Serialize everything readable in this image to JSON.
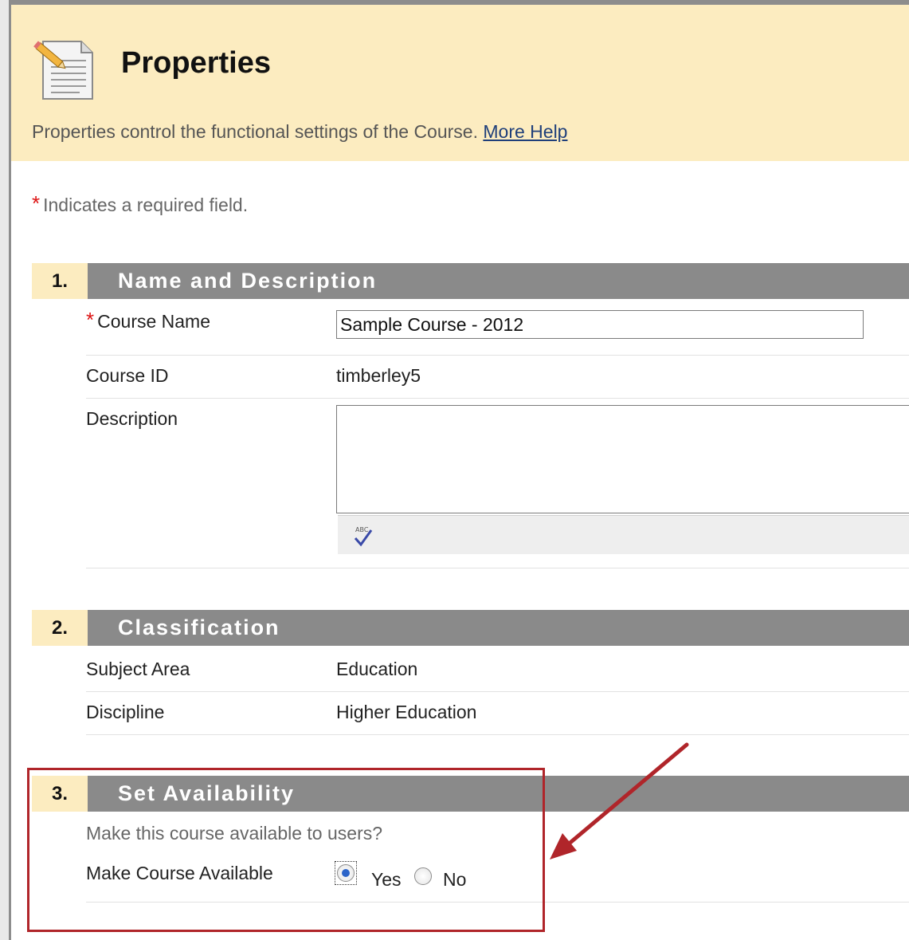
{
  "header": {
    "title": "Properties",
    "description": "Properties control the functional settings of the Course.",
    "help_link": "More Help"
  },
  "required_note": {
    "star": "*",
    "text": "Indicates a required field."
  },
  "sections": [
    {
      "number": "1.",
      "title": "Name and Description",
      "fields": {
        "course_name_label": "Course Name",
        "course_name_value": "Sample Course - 2012",
        "course_id_label": "Course ID",
        "course_id_value": "timberley5",
        "description_label": "Description",
        "description_value": ""
      }
    },
    {
      "number": "2.",
      "title": "Classification",
      "fields": {
        "subject_area_label": "Subject Area",
        "subject_area_value": "Education",
        "discipline_label": "Discipline",
        "discipline_value": "Higher Education"
      }
    },
    {
      "number": "3.",
      "title": "Set Availability",
      "fields": {
        "instruction": "Make this course available to users?",
        "available_label": "Make Course Available",
        "yes_label": "Yes",
        "no_label": "No",
        "selected": "Yes"
      }
    }
  ],
  "colors": {
    "header_bg": "#fcecc0",
    "section_bar": "#8a8a8a",
    "highlight": "#b0252a",
    "link": "#1f3f7a",
    "required_star": "#dd1111"
  },
  "icons": [
    "document-pencil-icon",
    "spellcheck-icon",
    "arrow-pointer"
  ]
}
